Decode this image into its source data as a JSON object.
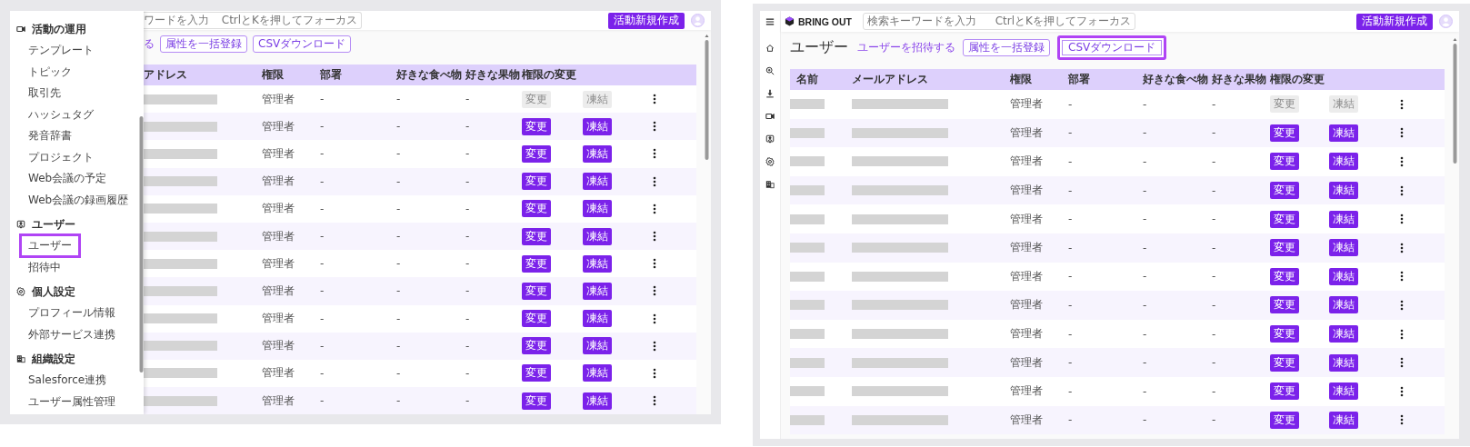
{
  "left_screen": {
    "drawer": {
      "sections": [
        {
          "title": "活動の運用",
          "items": [
            {
              "label": "テンプレート",
              "highlighted": false
            },
            {
              "label": "トピック",
              "highlighted": false
            },
            {
              "label": "取引先",
              "highlighted": false
            },
            {
              "label": "ハッシュタグ",
              "highlighted": false
            },
            {
              "label": "発音辞書",
              "highlighted": false
            },
            {
              "label": "プロジェクト",
              "highlighted": false
            },
            {
              "label": "Web会議の予定",
              "highlighted": false
            },
            {
              "label": "Web会議の録画履歴",
              "highlighted": false
            }
          ]
        },
        {
          "title": "ユーザー",
          "items": [
            {
              "label": "ユーザー",
              "highlighted": true
            },
            {
              "label": "招待中",
              "highlighted": false
            }
          ]
        },
        {
          "title": "個人設定",
          "items": [
            {
              "label": "プロフィール情報",
              "highlighted": false
            },
            {
              "label": "外部サービス連携",
              "highlighted": false
            }
          ]
        },
        {
          "title": "組織設定",
          "items": [
            {
              "label": "Salesforce連携",
              "highlighted": false
            },
            {
              "label": "ユーザー属性管理",
              "highlighted": false
            }
          ]
        }
      ]
    },
    "header": {
      "search": {
        "placeholder": "ワードを入力",
        "shortcut_hint": "CtrlとKを押してフォーカス"
      },
      "create_button": "活動新規作成"
    },
    "toolbar": {
      "invite_link": "る",
      "buttons": [
        {
          "label": "属性を一括登録",
          "highlighted": false
        },
        {
          "label": "CSVダウンロード",
          "highlighted": false
        }
      ]
    },
    "table": {
      "columns": [
        "アドレス",
        "権限",
        "部署",
        "好きな食べ物",
        "好きな果物",
        "権限の変更"
      ],
      "rows": [
        {
          "role": "管理者",
          "department": "-",
          "favorite_food": "-",
          "favorite_fruit": "-",
          "change_button": "変更",
          "freeze_button": "凍結",
          "disabled": true
        },
        {
          "role": "管理者",
          "department": "-",
          "favorite_food": "-",
          "favorite_fruit": "-",
          "change_button": "変更",
          "freeze_button": "凍結",
          "disabled": false
        },
        {
          "role": "管理者",
          "department": "-",
          "favorite_food": "-",
          "favorite_fruit": "-",
          "change_button": "変更",
          "freeze_button": "凍結",
          "disabled": false
        },
        {
          "role": "管理者",
          "department": "-",
          "favorite_food": "-",
          "favorite_fruit": "-",
          "change_button": "変更",
          "freeze_button": "凍結",
          "disabled": false
        },
        {
          "role": "管理者",
          "department": "-",
          "favorite_food": "-",
          "favorite_fruit": "-",
          "change_button": "変更",
          "freeze_button": "凍結",
          "disabled": false
        },
        {
          "role": "管理者",
          "department": "-",
          "favorite_food": "-",
          "favorite_fruit": "-",
          "change_button": "変更",
          "freeze_button": "凍結",
          "disabled": false
        },
        {
          "role": "管理者",
          "department": "-",
          "favorite_food": "-",
          "favorite_fruit": "-",
          "change_button": "変更",
          "freeze_button": "凍結",
          "disabled": false
        },
        {
          "role": "管理者",
          "department": "-",
          "favorite_food": "-",
          "favorite_fruit": "-",
          "change_button": "変更",
          "freeze_button": "凍結",
          "disabled": false
        },
        {
          "role": "管理者",
          "department": "-",
          "favorite_food": "-",
          "favorite_fruit": "-",
          "change_button": "変更",
          "freeze_button": "凍結",
          "disabled": false
        },
        {
          "role": "管理者",
          "department": "-",
          "favorite_food": "-",
          "favorite_fruit": "-",
          "change_button": "変更",
          "freeze_button": "凍結",
          "disabled": false
        },
        {
          "role": "管理者",
          "department": "-",
          "favorite_food": "-",
          "favorite_fruit": "-",
          "change_button": "変更",
          "freeze_button": "凍結",
          "disabled": false
        },
        {
          "role": "管理者",
          "department": "-",
          "favorite_food": "-",
          "favorite_fruit": "-",
          "change_button": "変更",
          "freeze_button": "凍結",
          "disabled": false
        }
      ]
    }
  },
  "right_screen": {
    "header": {
      "logo": "BRING OUT",
      "search": {
        "placeholder": "検索キーワードを入力",
        "shortcut_hint": "CtrlとKを押してフォーカス"
      },
      "create_button": "活動新規作成"
    },
    "toolbar": {
      "title": "ユーザー",
      "invite_link": "ユーザーを招待する",
      "buttons": [
        {
          "label": "属性を一括登録",
          "highlighted": false
        },
        {
          "label": "CSVダウンロード",
          "highlighted": true
        }
      ]
    },
    "table": {
      "columns": [
        "名前",
        "メールアドレス",
        "権限",
        "部署",
        "好きな食べ物",
        "好きな果物",
        "権限の変更"
      ],
      "rows": [
        {
          "role": "管理者",
          "department": "-",
          "favorite_food": "-",
          "favorite_fruit": "-",
          "change_button": "変更",
          "freeze_button": "凍結",
          "disabled": true
        },
        {
          "role": "管理者",
          "department": "-",
          "favorite_food": "-",
          "favorite_fruit": "-",
          "change_button": "変更",
          "freeze_button": "凍結",
          "disabled": false
        },
        {
          "role": "管理者",
          "department": "-",
          "favorite_food": "-",
          "favorite_fruit": "-",
          "change_button": "変更",
          "freeze_button": "凍結",
          "disabled": false
        },
        {
          "role": "管理者",
          "department": "-",
          "favorite_food": "-",
          "favorite_fruit": "-",
          "change_button": "変更",
          "freeze_button": "凍結",
          "disabled": false
        },
        {
          "role": "管理者",
          "department": "-",
          "favorite_food": "-",
          "favorite_fruit": "-",
          "change_button": "変更",
          "freeze_button": "凍結",
          "disabled": false
        },
        {
          "role": "管理者",
          "department": "-",
          "favorite_food": "-",
          "favorite_fruit": "-",
          "change_button": "変更",
          "freeze_button": "凍結",
          "disabled": false
        },
        {
          "role": "管理者",
          "department": "-",
          "favorite_food": "-",
          "favorite_fruit": "-",
          "change_button": "変更",
          "freeze_button": "凍結",
          "disabled": false
        },
        {
          "role": "管理者",
          "department": "-",
          "favorite_food": "-",
          "favorite_fruit": "-",
          "change_button": "変更",
          "freeze_button": "凍結",
          "disabled": false
        },
        {
          "role": "管理者",
          "department": "-",
          "favorite_food": "-",
          "favorite_fruit": "-",
          "change_button": "変更",
          "freeze_button": "凍結",
          "disabled": false
        },
        {
          "role": "管理者",
          "department": "-",
          "favorite_food": "-",
          "favorite_fruit": "-",
          "change_button": "変更",
          "freeze_button": "凍結",
          "disabled": false
        },
        {
          "role": "管理者",
          "department": "-",
          "favorite_food": "-",
          "favorite_fruit": "-",
          "change_button": "変更",
          "freeze_button": "凍結",
          "disabled": false
        },
        {
          "role": "管理者",
          "department": "-",
          "favorite_food": "-",
          "favorite_fruit": "-",
          "change_button": "変更",
          "freeze_button": "凍結",
          "disabled": false
        }
      ]
    }
  }
}
